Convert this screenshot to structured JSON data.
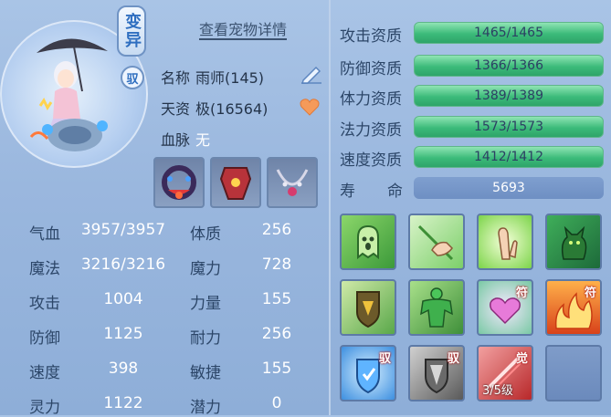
{
  "pet": {
    "transform_label": "变异",
    "ride_badge": "驭",
    "detail_link": "查看宠物详情",
    "name_label": "名称",
    "name_value": "雨师(145)",
    "talent_label": "天资",
    "talent_value": "极(16564)",
    "blood_label": "血脉",
    "blood_value": "无"
  },
  "stats": [
    {
      "label": "气血",
      "value": "3957/3957",
      "label2": "体质",
      "value2": "256"
    },
    {
      "label": "魔法",
      "value": "3216/3216",
      "label2": "魔力",
      "value2": "728"
    },
    {
      "label": "攻击",
      "value": "1004",
      "label2": "力量",
      "value2": "155"
    },
    {
      "label": "防御",
      "value": "1125",
      "label2": "耐力",
      "value2": "256"
    },
    {
      "label": "速度",
      "value": "398",
      "label2": "敏捷",
      "value2": "155"
    },
    {
      "label": "灵力",
      "value": "1122",
      "label2": "潜力",
      "value2": "0"
    }
  ],
  "aptitudes": [
    {
      "label": "攻击资质",
      "value": "1465/1465",
      "fill": 1.0
    },
    {
      "label": "防御资质",
      "value": "1366/1366",
      "fill": 1.0
    },
    {
      "label": "体力资质",
      "value": "1389/1389",
      "fill": 1.0
    },
    {
      "label": "法力资质",
      "value": "1573/1573",
      "fill": 1.0
    },
    {
      "label": "速度资质",
      "value": "1412/1412",
      "fill": 1.0
    }
  ],
  "life": {
    "label_a": "寿",
    "label_b": "命",
    "value": "5693"
  },
  "skills": {
    "tag_fu": "符",
    "tag_yu": "驭",
    "tag_jue": "觉",
    "awaken_level": "3/5级"
  },
  "colors": {
    "bar_green": "#3cbb7a",
    "bar_blue": "#6e8fc3",
    "label_dark": "#2c4668"
  }
}
